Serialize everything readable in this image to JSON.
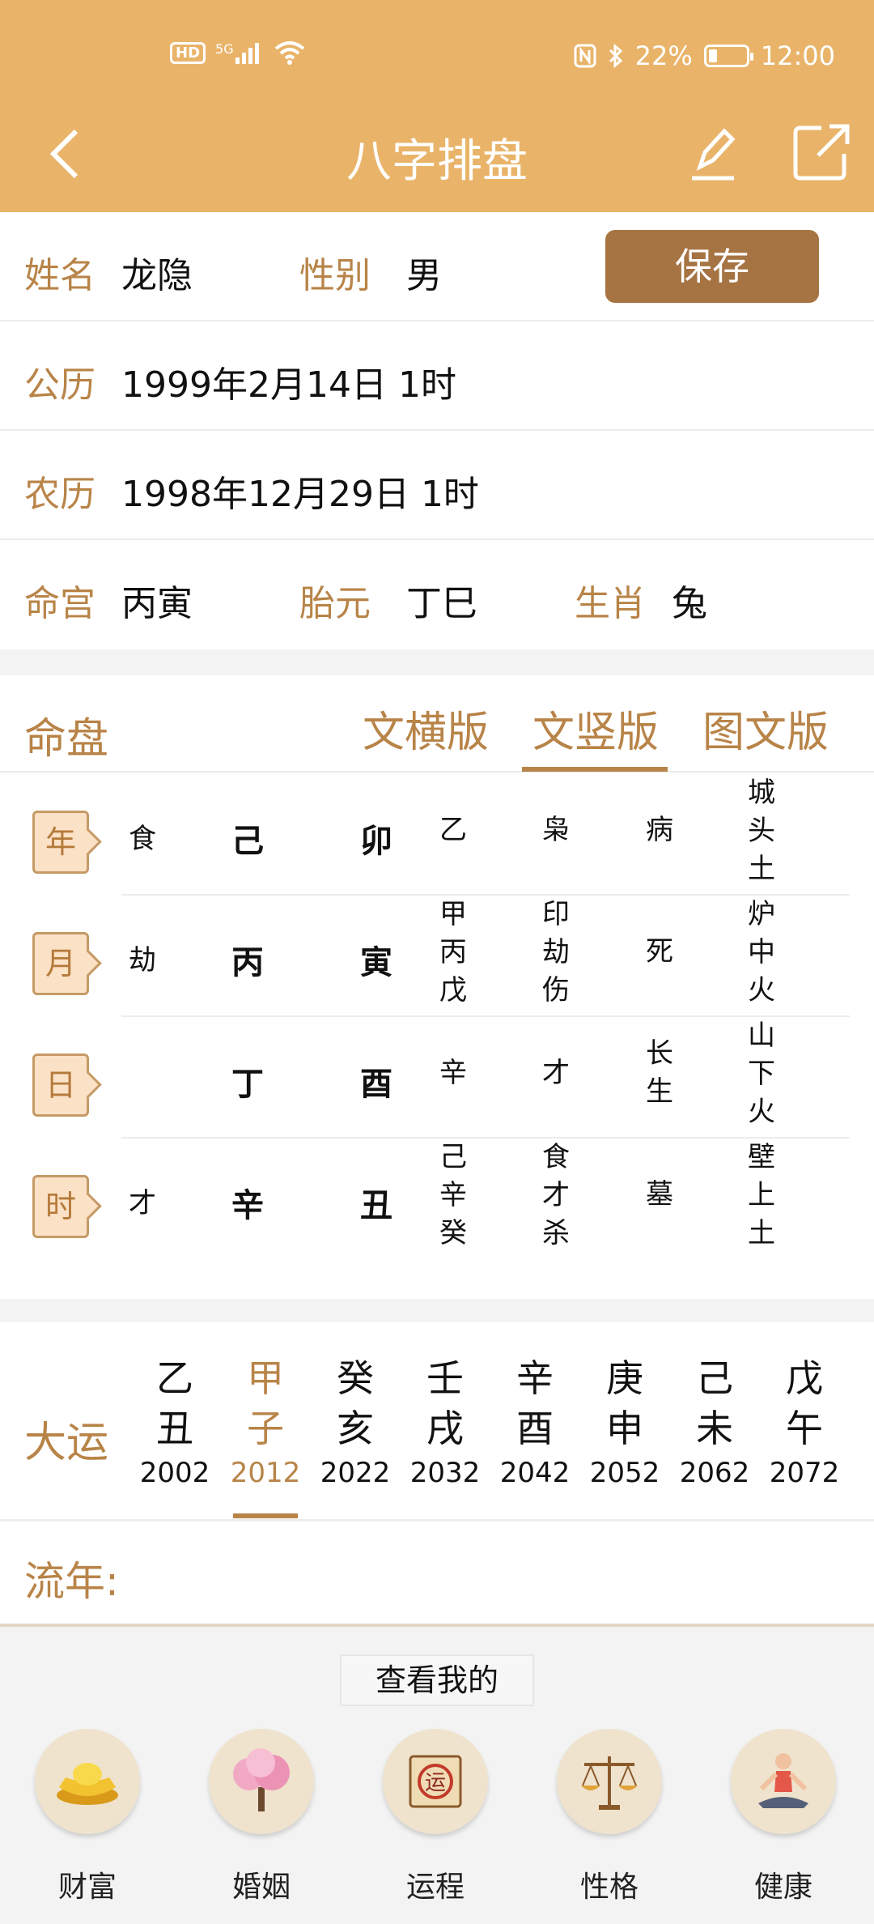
{
  "status_bar": {
    "left_icons": [
      "hd-icon",
      "signal-5g-icon",
      "wifi-icon"
    ],
    "hd_text": "HD",
    "signal_text": "5G",
    "battery": "22%",
    "battery_level": 0.22,
    "time": "12:00"
  },
  "toolbar": {
    "title": "八字排盘",
    "back": "<"
  },
  "info": {
    "name_label": "姓名",
    "name": "龙隐",
    "gender_label": "性别",
    "gender": "男",
    "save": "保存",
    "solar_label": "公历",
    "solar": "1999年2月14日 1时",
    "lunar_label": "农历",
    "lunar": "1998年12月29日 1时",
    "minggong_label": "命宫",
    "minggong": "丙寅",
    "taiyuan_label": "胎元",
    "taiyuan": "丁巳",
    "shengxiao_label": "生肖",
    "shengxiao": "兔"
  },
  "chart": {
    "section_label": "命盘",
    "tabs": [
      "文横版",
      "文竖版",
      "图文版"
    ],
    "active_tab": "文竖版",
    "rows": [
      {
        "pillar": "年",
        "ss": "食",
        "gan": "己",
        "zhi": "卯",
        "cg": "乙",
        "cgss": "枭",
        "cs": "病",
        "ny": "城头土"
      },
      {
        "pillar": "月",
        "ss": "劫",
        "gan": "丙",
        "zhi": "寅",
        "cg": "甲丙戊",
        "cgss": "印劫伤",
        "cs": "死",
        "ny": "炉中火"
      },
      {
        "pillar": "日",
        "ss": "",
        "gan": "丁",
        "zhi": "酉",
        "cg": "辛",
        "cgss": "才",
        "cs": "长生",
        "ny": "山下火"
      },
      {
        "pillar": "时",
        "ss": "才",
        "gan": "辛",
        "zhi": "丑",
        "cg": "己辛癸",
        "cgss": "食才杀",
        "cs": "墓",
        "ny": "壁上土"
      }
    ]
  },
  "dayun": {
    "label": "大运",
    "active_index": 1,
    "items": [
      {
        "g": "乙",
        "z": "丑",
        "y": "2002"
      },
      {
        "g": "甲",
        "z": "子",
        "y": "2012"
      },
      {
        "g": "癸",
        "z": "亥",
        "y": "2022"
      },
      {
        "g": "壬",
        "z": "戌",
        "y": "2032"
      },
      {
        "g": "辛",
        "z": "酉",
        "y": "2042"
      },
      {
        "g": "庚",
        "z": "申",
        "y": "2052"
      },
      {
        "g": "己",
        "z": "未",
        "y": "2062"
      },
      {
        "g": "戊",
        "z": "午",
        "y": "2072"
      }
    ]
  },
  "liunian": {
    "label": "流年:"
  },
  "bottom": {
    "see_mine": "查看我的",
    "features": [
      {
        "label": "财富",
        "icon": "gold-ingot-icon"
      },
      {
        "label": "婚姻",
        "icon": "blossom-tree-icon"
      },
      {
        "label": "运程",
        "icon": "fortune-scroll-icon"
      },
      {
        "label": "性格",
        "icon": "balance-scale-icon"
      },
      {
        "label": "健康",
        "icon": "yoga-person-icon"
      }
    ],
    "scroll_char": "运"
  },
  "colors": {
    "header": "#e9b46a",
    "accent": "#b88448",
    "save_button": "#a67443"
  }
}
